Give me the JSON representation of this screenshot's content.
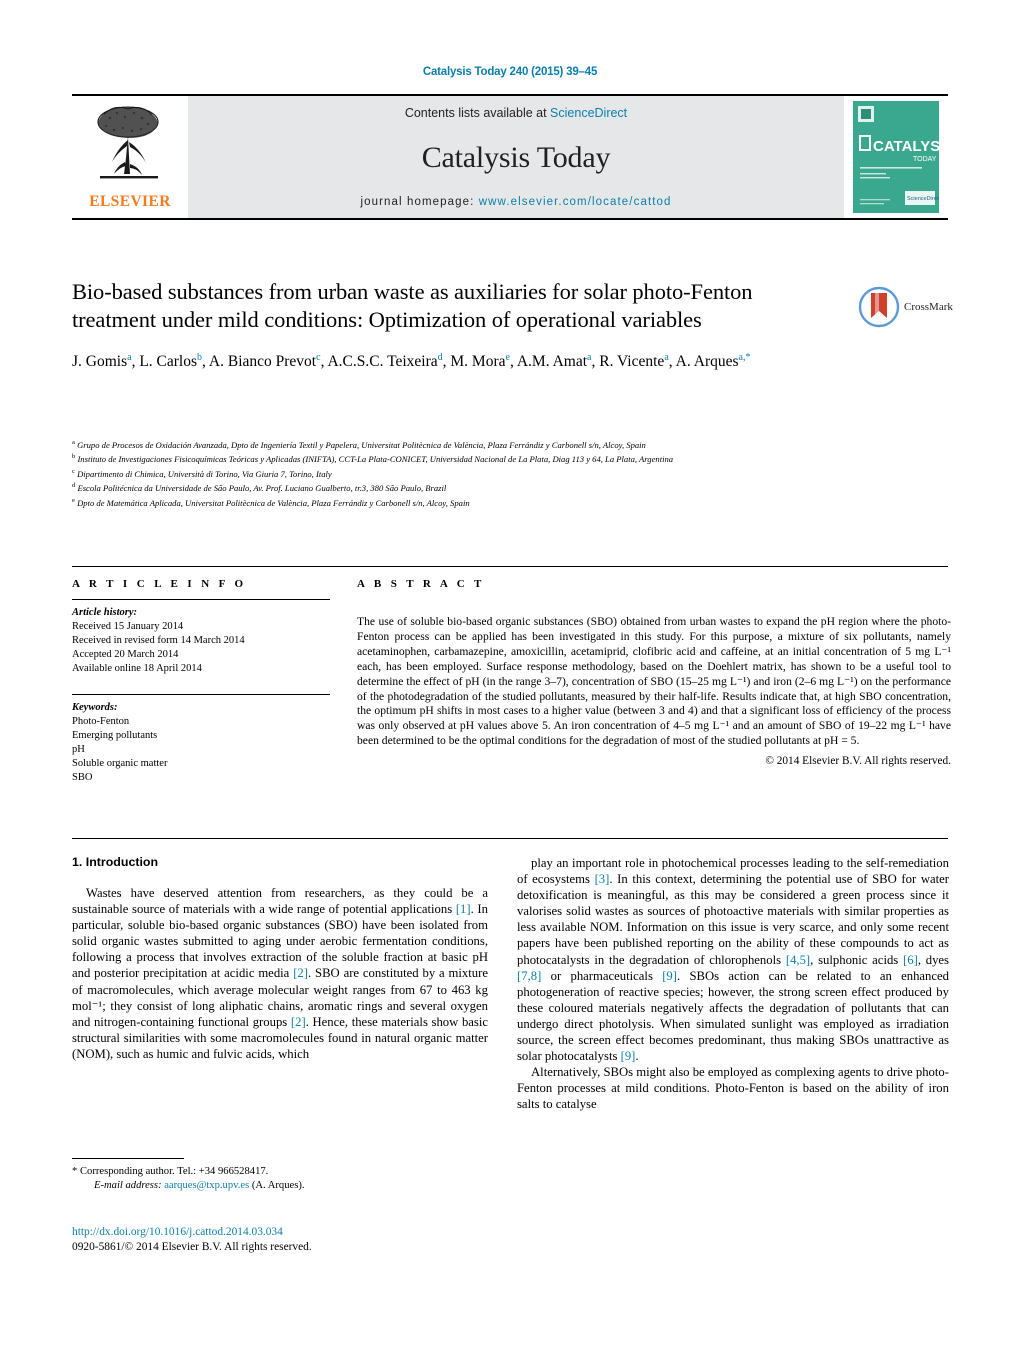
{
  "running_head": "Catalysis Today 240 (2015) 39–45",
  "masthead": {
    "publisher": "ELSEVIER",
    "contents_prefix": "Contents lists available at ",
    "contents_link": "ScienceDirect",
    "journal_title": "Catalysis Today",
    "homepage_prefix": "journal homepage: ",
    "homepage_url": "www.elsevier.com/locate/cattod",
    "cover_title": "CATALYSIS",
    "cover_subtitle": "TODAY",
    "cover_footer": "ScienceDirect"
  },
  "article": {
    "title": "Bio-based substances from urban waste as auxiliaries for solar photo-Fenton treatment under mild conditions: Optimization of operational variables",
    "crossmark_label": "CrossMark",
    "authors": [
      {
        "name": "J. Gomis",
        "marks": "a",
        "sep": ", "
      },
      {
        "name": "L. Carlos",
        "marks": "b",
        "sep": ", "
      },
      {
        "name": "A. Bianco Prevot",
        "marks": "c",
        "sep": ", "
      },
      {
        "name": "A.C.S.C. Teixeira",
        "marks": "d",
        "sep": ", "
      },
      {
        "name": "M. Mora",
        "marks": "e",
        "sep": ", "
      },
      {
        "name": "A.M. Amat",
        "marks": "a",
        "sep": ", "
      },
      {
        "name": "R. Vicente",
        "marks": "a",
        "sep": ", "
      },
      {
        "name": "A. Arques",
        "marks": "a,*",
        "sep": ""
      }
    ],
    "affiliations": [
      {
        "mark": "a",
        "text": "Grupo de Procesos de Oxidación Avanzada, Dpto de Ingeniería Textil y Papelera, Universitat Politècnica de València, Plaza Ferrándiz y Carbonell s/n, Alcoy, Spain"
      },
      {
        "mark": "b",
        "text": "Instituto de Investigaciones Fisicoquímicas Teóricas y Aplicadas (INIFTA), CCT-La Plata-CONICET, Universidad Nacional de La Plata, Diag 113 y 64, La Plata, Argentina"
      },
      {
        "mark": "c",
        "text": "Dipartimento di Chimica, Università di Torino, Via Giuria 7, Torino, Italy"
      },
      {
        "mark": "d",
        "text": "Escola Politécnica da Universidade de São Paulo, Av. Prof. Luciano Gualberto, tr.3, 380 São Paulo, Brazil"
      },
      {
        "mark": "e",
        "text": "Dpto de Matemática Aplicada, Universitat Politècnica de València, Plaza Ferrándiz y Carbonell s/n, Alcoy, Spain"
      }
    ]
  },
  "article_info": {
    "heading": "A R T I C L E    I N F O",
    "history_label": "Article history:",
    "history": [
      "Received 15 January 2014",
      "Received in revised form 14 March 2014",
      "Accepted 20 March 2014",
      "Available online 18 April 2014"
    ],
    "keywords_label": "Keywords:",
    "keywords": [
      "Photo-Fenton",
      "Emerging pollutants",
      "pH",
      "Soluble organic matter",
      "SBO"
    ]
  },
  "abstract": {
    "heading": "A B S T R A C T",
    "text": "The use of soluble bio-based organic substances (SBO) obtained from urban wastes to expand the pH region where the photo-Fenton process can be applied has been investigated in this study. For this purpose, a mixture of six pollutants, namely acetaminophen, carbamazepine, amoxicillin, acetamiprid, clofibric acid and caffeine, at an initial concentration of 5 mg L⁻¹ each, has been employed. Surface response methodology, based on the Doehlert matrix, has shown to be a useful tool to determine the effect of pH (in the range 3–7), concentration of SBO (15–25 mg L⁻¹) and iron (2–6 mg L⁻¹) on the performance of the photodegradation of the studied pollutants, measured by their half-life. Results indicate that, at high SBO concentration, the optimum pH shifts in most cases to a higher value (between 3 and 4) and that a significant loss of efficiency of the process was only observed at pH values above 5. An iron concentration of 4–5 mg L⁻¹ and an amount of SBO of 19–22 mg L⁻¹ have been determined to be the optimal conditions for the degradation of most of the studied pollutants at pH = 5.",
    "copyright": "© 2014 Elsevier B.V. All rights reserved."
  },
  "body": {
    "intro_heading": "1.  Introduction",
    "left_paragraphs": [
      "Wastes have deserved attention from researchers, as they could be a sustainable source of materials with a wide range of potential applications [1]. In particular, soluble bio-based organic substances (SBO) have been isolated from solid organic wastes submitted to aging under aerobic fermentation conditions, following a process that involves extraction of the soluble fraction at basic pH and posterior precipitation at acidic media [2]. SBO are constituted by a mixture of macromolecules, which average molecular weight ranges from 67 to 463 kg mol⁻¹; they consist of long aliphatic chains, aromatic rings and several oxygen and nitrogen-containing functional groups [2]. Hence, these materials show basic structural similarities with some macromolecules found in natural organic matter (NOM), such as humic and fulvic acids, which"
    ],
    "right_paragraphs": [
      "play an important role in photochemical processes leading to the self-remediation of ecosystems [3]. In this context, determining the potential use of SBO for water detoxification is meaningful, as this may be considered a green process since it valorises solid wastes as sources of photoactive materials with similar properties as less available NOM. Information on this issue is very scarce, and only some recent papers have been published reporting on the ability of these compounds to act as photocatalysts in the degradation of chlorophenols [4,5], sulphonic acids [6], dyes [7,8] or pharmaceuticals [9]. SBOs action can be related to an enhanced photogeneration of reactive species; however, the strong screen effect produced by these coloured materials negatively affects the degradation of pollutants that can undergo direct photolysis. When simulated sunlight was employed as irradiation source, the screen effect becomes predominant, thus making SBOs unattractive as solar photocatalysts [9].",
      "Alternatively, SBOs might also be employed as complexing agents to drive photo-Fenton processes at mild conditions. Photo-Fenton is based on the ability of iron salts to catalyse"
    ]
  },
  "footer": {
    "corresponding_marker": "*",
    "corresponding_text": "Corresponding author. Tel.: +34 966528417.",
    "email_label": "E-mail address:",
    "email": "aarques@txp.upv.es",
    "email_suffix": "(A. Arques).",
    "doi": "http://dx.doi.org/10.1016/j.cattod.2014.03.034",
    "issn": "0920-5861/© 2014 Elsevier B.V. All rights reserved."
  },
  "colors": {
    "link": "#0b7fab",
    "elsevier_orange": "#F47B20",
    "masthead_grey": "#e6e7e8"
  }
}
